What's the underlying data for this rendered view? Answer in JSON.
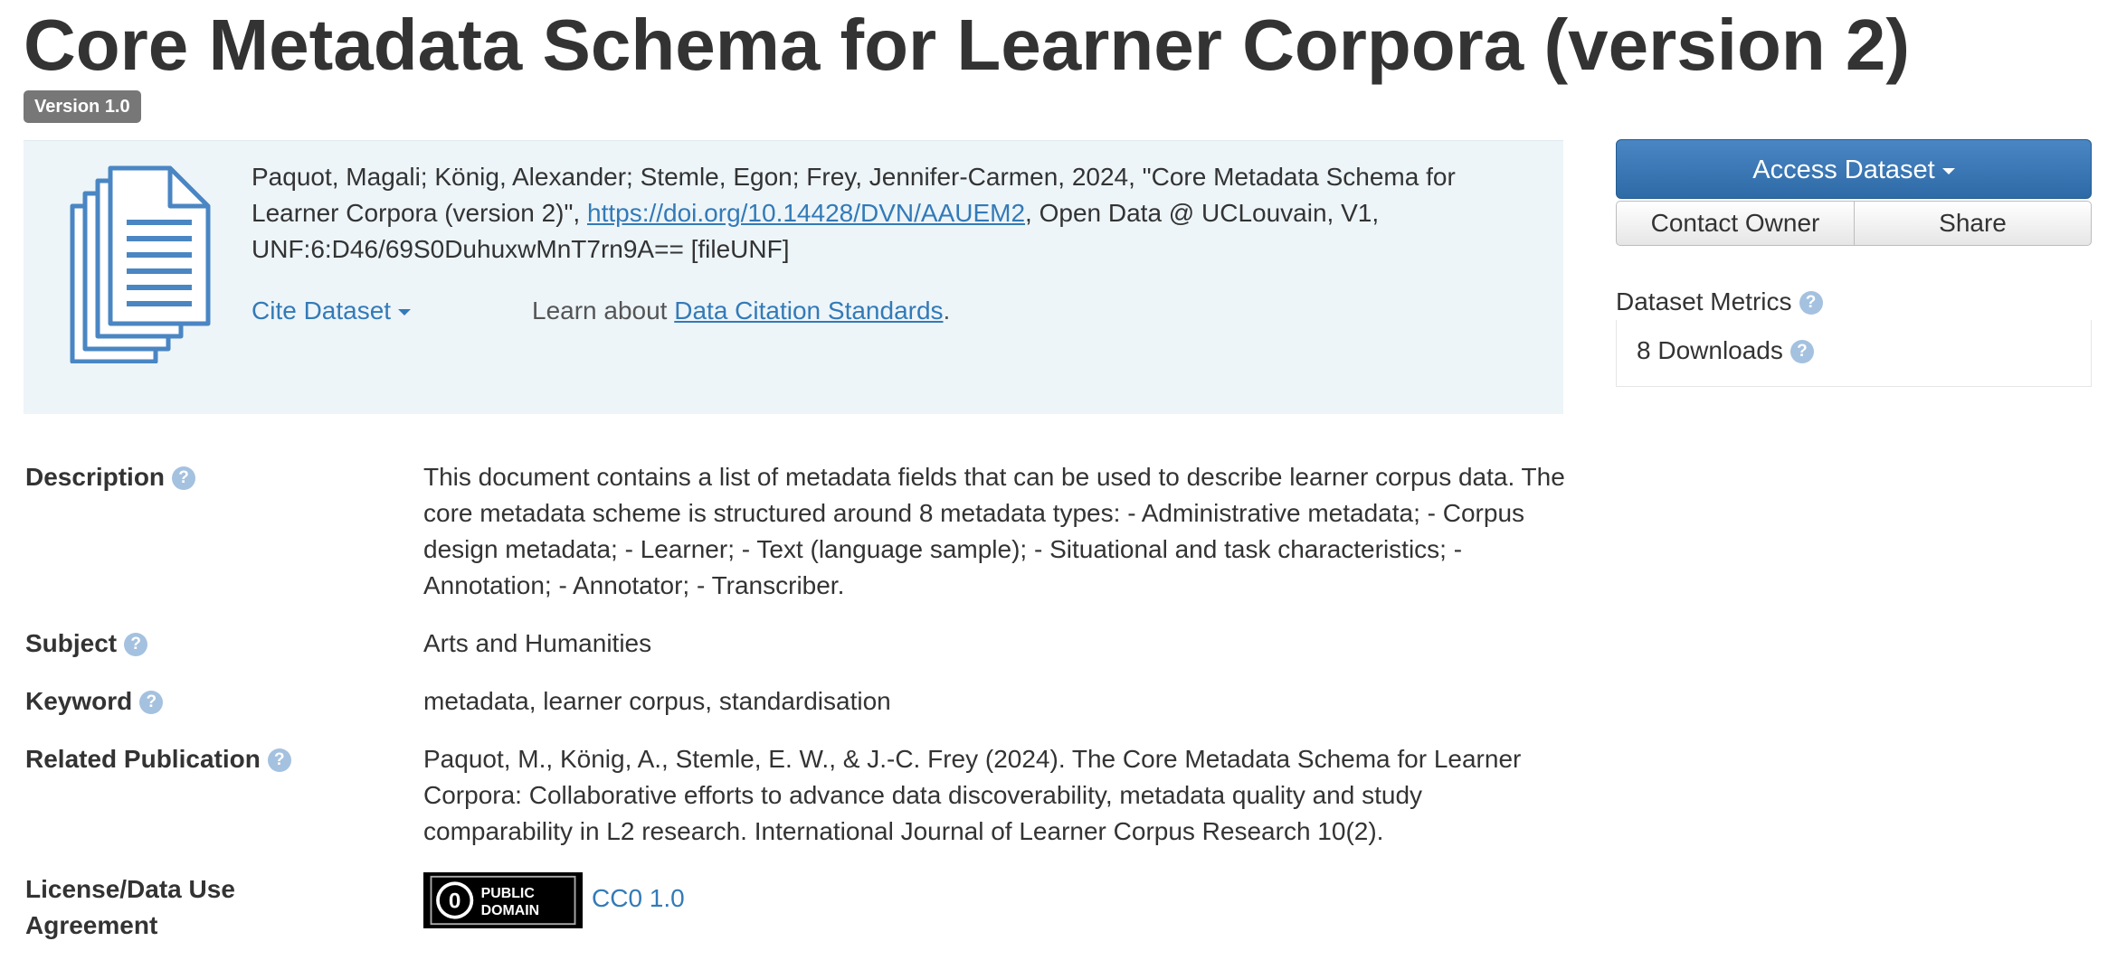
{
  "dataset": {
    "title": "Core Metadata Schema for Learner Corpora (version 2)",
    "version_badge": "Version 1.0"
  },
  "citation": {
    "text_before_link": "Paquot, Magali; König, Alexander; Stemle, Egon; Frey, Jennifer-Carmen, 2024, \"Core Metadata Schema for Learner Corpora (version 2)\", ",
    "doi_link": "https://doi.org/10.14428/DVN/AAUEM2",
    "text_after_link": ", Open Data @ UCLouvain, V1, UNF:6:D46/69S0DuhuxwMnT7rn9A== [fileUNF]",
    "cite_dataset_label": "Cite Dataset",
    "learn_about_prefix": "Learn about ",
    "learn_about_link": "Data Citation Standards",
    "learn_about_suffix": ".",
    "icon": "document-stack-icon"
  },
  "actions": {
    "access_dataset_label": "Access Dataset",
    "contact_owner_label": "Contact Owner",
    "share_label": "Share"
  },
  "metrics": {
    "title": "Dataset Metrics",
    "downloads_label": "8 Downloads"
  },
  "metadata": {
    "description_label": "Description",
    "description_value": "This document contains a list of metadata fields that can be used to describe learner corpus data. The core metadata scheme is structured around 8 metadata types: - Administrative metadata; - Corpus design metadata; - Learner; - Text (language sample); - Situational and task characteristics; - Annotation; - Annotator; - Transcriber.",
    "subject_label": "Subject",
    "subject_value": "Arts and Humanities",
    "keyword_label": "Keyword",
    "keyword_value": "metadata, learner corpus, standardisation",
    "related_publication_label": "Related Publication",
    "related_publication_value": "Paquot, M., König, A., Stemle, E. W., & J.-C. Frey (2024). The Core Metadata Schema for Learner Corpora: Collaborative efforts to advance data discoverability, metadata quality and study comparability in L2 research. International Journal of Learner Corpus Research 10(2).",
    "license_label": "License/Data Use Agreement",
    "license_badge_line1": "PUBLIC",
    "license_badge_line2": "DOMAIN",
    "license_badge_symbol": "0",
    "license_value": "CC0 1.0"
  },
  "help_icon_glyph": "?",
  "colors": {
    "link": "#337ab7",
    "citation_background": "#edf5f9",
    "primary_button": "#2d6aa6",
    "badge": "#777777",
    "help_icon": "#a4c1e0"
  }
}
